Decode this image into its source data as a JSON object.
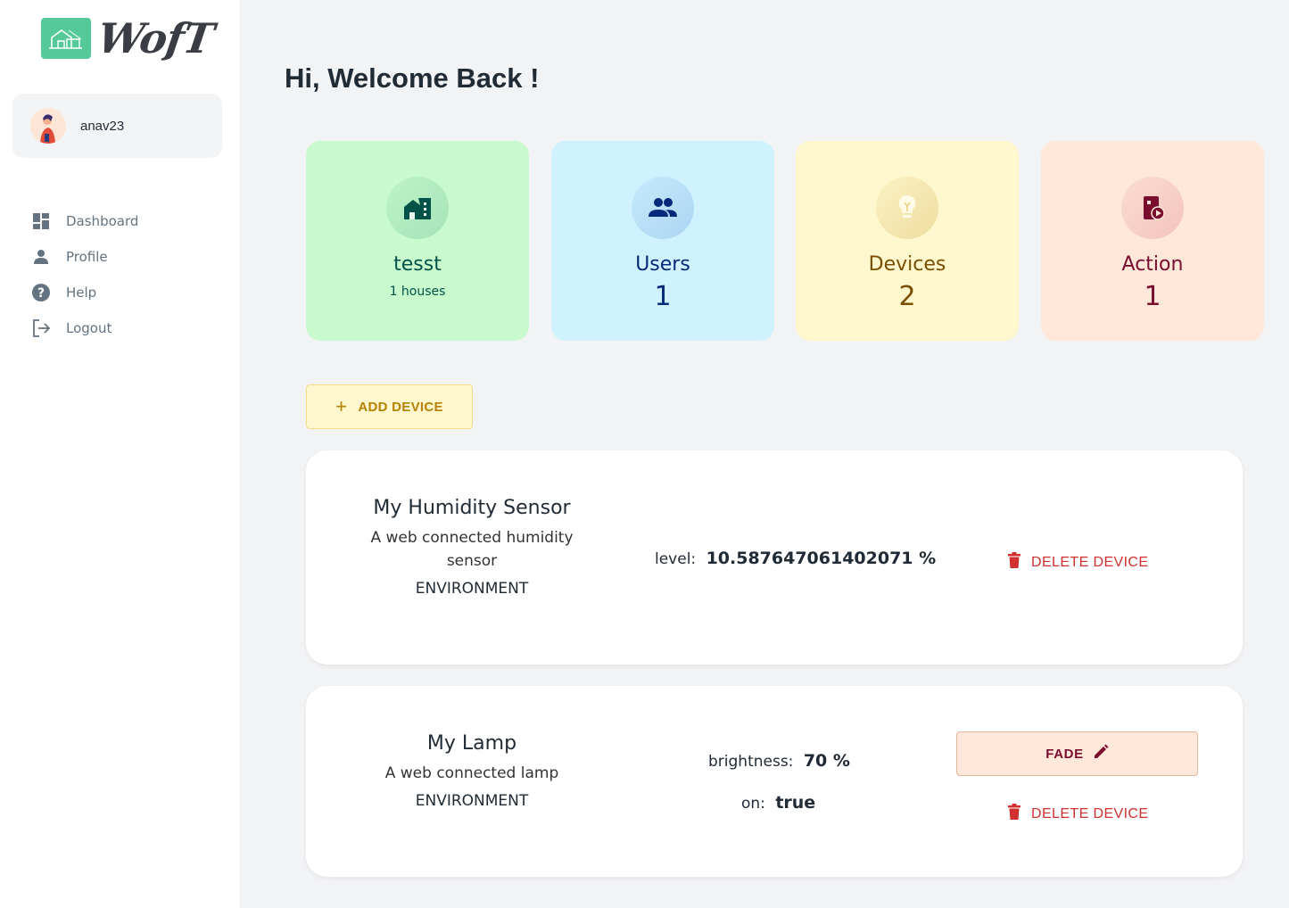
{
  "app": {
    "logo_text": "WofT"
  },
  "account": {
    "username": "anav23"
  },
  "nav": [
    {
      "label": "Dashboard",
      "icon": "dashboard-icon"
    },
    {
      "label": "Profile",
      "icon": "person-icon"
    },
    {
      "label": "Help",
      "icon": "help-icon"
    },
    {
      "label": "Logout",
      "icon": "logout-icon"
    }
  ],
  "welcome": "Hi, Welcome Back !",
  "stats": {
    "house": {
      "title": "tesst",
      "sub": "1 houses",
      "icon": "house-icon"
    },
    "users": {
      "title": "Users",
      "value": "1",
      "icon": "users-icon"
    },
    "devices": {
      "title": "Devices",
      "value": "2",
      "icon": "bulb-icon"
    },
    "action": {
      "title": "Action",
      "value": "1",
      "icon": "action-icon"
    }
  },
  "add_device_label": "ADD DEVICE",
  "devices": [
    {
      "name": "My Humidity Sensor",
      "description": "A web connected humidity sensor",
      "category": "ENVIRONMENT",
      "props": [
        {
          "key": "level:",
          "value": "10.587647061402071 %"
        }
      ],
      "delete_label": "DELETE DEVICE"
    },
    {
      "name": "My Lamp",
      "description": "A web connected lamp",
      "category": "ENVIRONMENT",
      "props": [
        {
          "key": "brightness:",
          "value": "70 %"
        },
        {
          "key": "on:",
          "value": "true"
        }
      ],
      "action_label": "FADE",
      "delete_label": "DELETE DEVICE"
    }
  ],
  "colors": {
    "accent_green": "#56c99a",
    "delete_red": "#d0302f",
    "add_yellow": "#b78103"
  }
}
